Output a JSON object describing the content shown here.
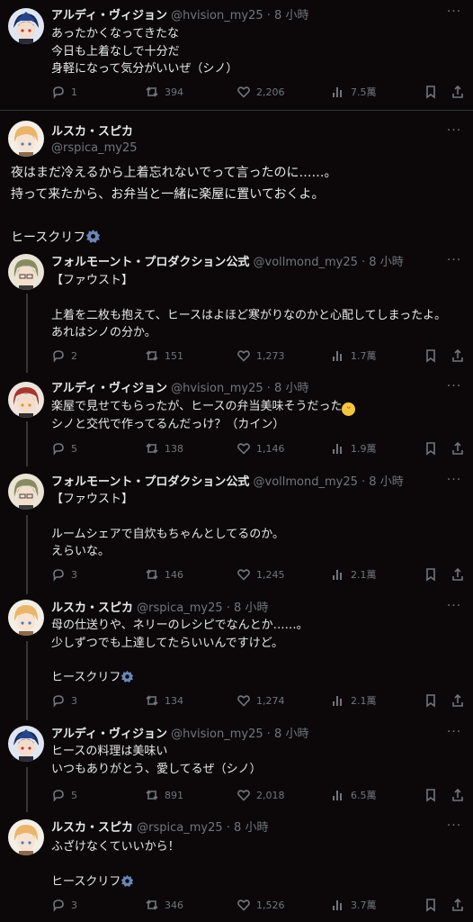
{
  "tweets": [
    {
      "name": "アルディ・ヴィジョン",
      "handle": "@hvision_my25",
      "time": "· 8 小時",
      "lines": [
        "あったかくなってきたな",
        "今日も上着なしで十分だ",
        "身軽になって気分がいいぜ（シノ）"
      ],
      "reply": "1",
      "retweet": "394",
      "like": "2,206",
      "view": "7.5萬"
    },
    {
      "name": "ルスカ・スピカ",
      "handle": "@rspica_my25",
      "lines": [
        "夜はまだ冷えるから上着忘れないでって言ったのに……。",
        "持って来たから、お弁当と一緒に楽屋に置いておくよ。",
        "",
        "ヒースクリフ"
      ]
    },
    {
      "name": "フォルモーント・プロダクション公式",
      "handle": "@vollmond_my25",
      "time": "· 8 小時",
      "lines": [
        "【ファウスト】",
        "",
        "上着を二枚も抱えて、ヒースはよほど寒がりなのかと心配してしまったよ。",
        "あれはシノの分か。"
      ],
      "reply": "2",
      "retweet": "151",
      "like": "1,273",
      "view": "1.7萬"
    },
    {
      "name": "アルディ・ヴィジョン",
      "handle": "@hvision_my25",
      "time": "· 8 小時",
      "lines": [
        "楽屋で見せてもらったが、ヒースの弁当美味そうだった",
        "シノと交代で作ってるんだっけ？（カイン）"
      ],
      "reply": "5",
      "retweet": "138",
      "like": "1,146",
      "view": "1.9萬"
    },
    {
      "name": "フォルモーント・プロダクション公式",
      "handle": "@vollmond_my25",
      "time": "· 8 小時",
      "lines": [
        "【ファウスト】",
        "",
        "ルームシェアで自炊もちゃんとしてるのか。",
        "えらいな。"
      ],
      "reply": "3",
      "retweet": "146",
      "like": "1,245",
      "view": "2.1萬"
    },
    {
      "name": "ルスカ・スピカ",
      "handle": "@rspica_my25",
      "time": "· 8 小時",
      "lines": [
        "母の仕送りや、ネリーのレシピでなんとか……。",
        "少しずつでも上達してたらいいんですけど。",
        "",
        "ヒースクリフ"
      ],
      "reply": "3",
      "retweet": "134",
      "like": "1,274",
      "view": "2.1萬"
    },
    {
      "name": "アルディ・ヴィジョン",
      "handle": "@hvision_my25",
      "time": "· 8 小時",
      "lines": [
        "ヒースの料理は美味い",
        "いつもありがとう、愛してるぜ（シノ）"
      ],
      "reply": "5",
      "retweet": "891",
      "like": "2,018",
      "view": "6.5萬"
    },
    {
      "name": "ルスカ・スピカ",
      "handle": "@rspica_my25",
      "time": "· 8 小時",
      "lines": [
        "ふざけなくていいから！",
        "",
        "ヒースクリフ"
      ],
      "reply": "3",
      "retweet": "346",
      "like": "1,526",
      "view": "3.7萬"
    }
  ],
  "icons": {
    "reply": "reply-icon",
    "retweet": "retweet-icon",
    "like": "heart-icon",
    "view": "views-icon",
    "bookmark": "bookmark-icon",
    "share": "share-icon",
    "gear": "gear-icon",
    "emoji": "grinning-face-emoji"
  },
  "colors": {
    "background": "#0c0809",
    "text": "#e7e9ea",
    "muted": "#71767b",
    "divider": "#2f3336",
    "gear": "#6a87b8"
  }
}
